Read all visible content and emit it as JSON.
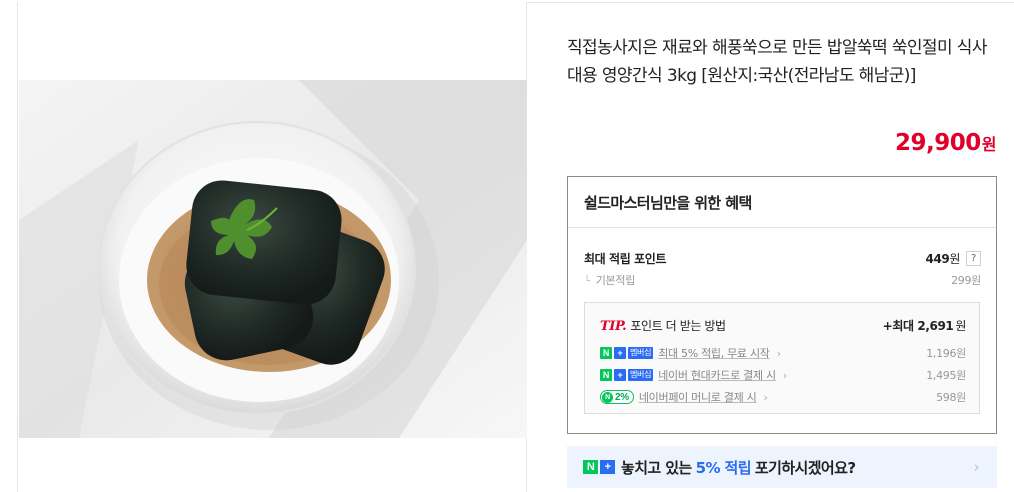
{
  "product": {
    "title": "직접농사지은 재료와 해풍쑥으로 만든 밥알쑥떡 쑥인절미 식사대용 영양간식 3kg [원산지:국산(전라남도 해남군)]",
    "price_value": "29,900",
    "price_unit": "원"
  },
  "benefit": {
    "heading": "쉴드마스터님만을 위한 혜택",
    "max_label": "최대 적립 포인트",
    "max_value": "449",
    "max_unit": "원",
    "help_glyph": "?",
    "base_tree": "└",
    "base_label": "기본적립",
    "base_value": "299원"
  },
  "tip": {
    "tip_word": "TIP.",
    "heading": "포인트 더 받는 방법",
    "max_prefix": "+최대",
    "max_value": "2,691",
    "max_unit": "원",
    "items": [
      {
        "badge": "membership",
        "label": "최대 5% 적립, 무료 시작",
        "chevron": "›",
        "amount": "1,196원"
      },
      {
        "badge": "membership",
        "label": "네이버 현대카드로 결제 시",
        "chevron": "›",
        "amount": "1,495원"
      },
      {
        "badge": "npay",
        "label": "네이버페이 머니로 결제 시",
        "chevron": "›",
        "amount": "598원"
      }
    ],
    "badge_n": "N",
    "badge_plus": "+",
    "badge_membership": "멤버십",
    "npay_circle": "N",
    "npay_pct": "2%"
  },
  "banner": {
    "badge_n": "N",
    "badge_plus": "+",
    "text_before": "놓치고 있는",
    "highlight": "5% 적립",
    "text_after": "포기하시겠어요?",
    "arrow": "›"
  },
  "colors": {
    "price": "#e0002a",
    "naver_green": "#03c75a",
    "naver_blue": "#2b6cf5",
    "banner_bg": "#eef4fd"
  },
  "icons": {
    "help": "question-mark-box",
    "chevron": "chevron-right-icon",
    "banner_arrow": "chevron-right-icon"
  }
}
